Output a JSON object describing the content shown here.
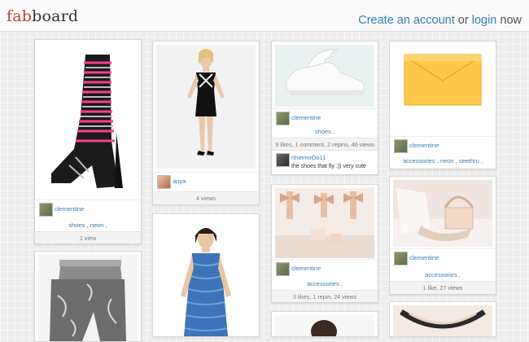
{
  "header": {
    "logo_fab": "fab",
    "logo_board": "board",
    "create_account": "Create an account",
    "or": "or",
    "login": "login",
    "now": "now"
  },
  "pins": [
    {
      "user": "clementine",
      "tags": [
        "shoes",
        "neon"
      ],
      "stats": "1 view"
    },
    {
      "user": "anya",
      "stats": "4 views"
    },
    {
      "user": "clementine",
      "tags": [
        "shoes"
      ],
      "stats": "9 likes, 1 comment, 2 repins, 46 views",
      "comment": {
        "user": "nhiemoOo11",
        "text": "the shoes that fly :)) very cute"
      }
    },
    {
      "user": "clementine",
      "tags": [
        "accessories",
        "neon",
        "seethru"
      ]
    },
    {
      "user": "clementine",
      "tags": [
        "accessories"
      ],
      "stats": "3 likes, 1 repin, 24 views"
    },
    {
      "user": "clementine",
      "tags": [
        "accessories"
      ],
      "stats": "1 like, 27 views"
    }
  ],
  "colors": {
    "accent": "#2f7fb3",
    "logo": "#c2402a"
  }
}
